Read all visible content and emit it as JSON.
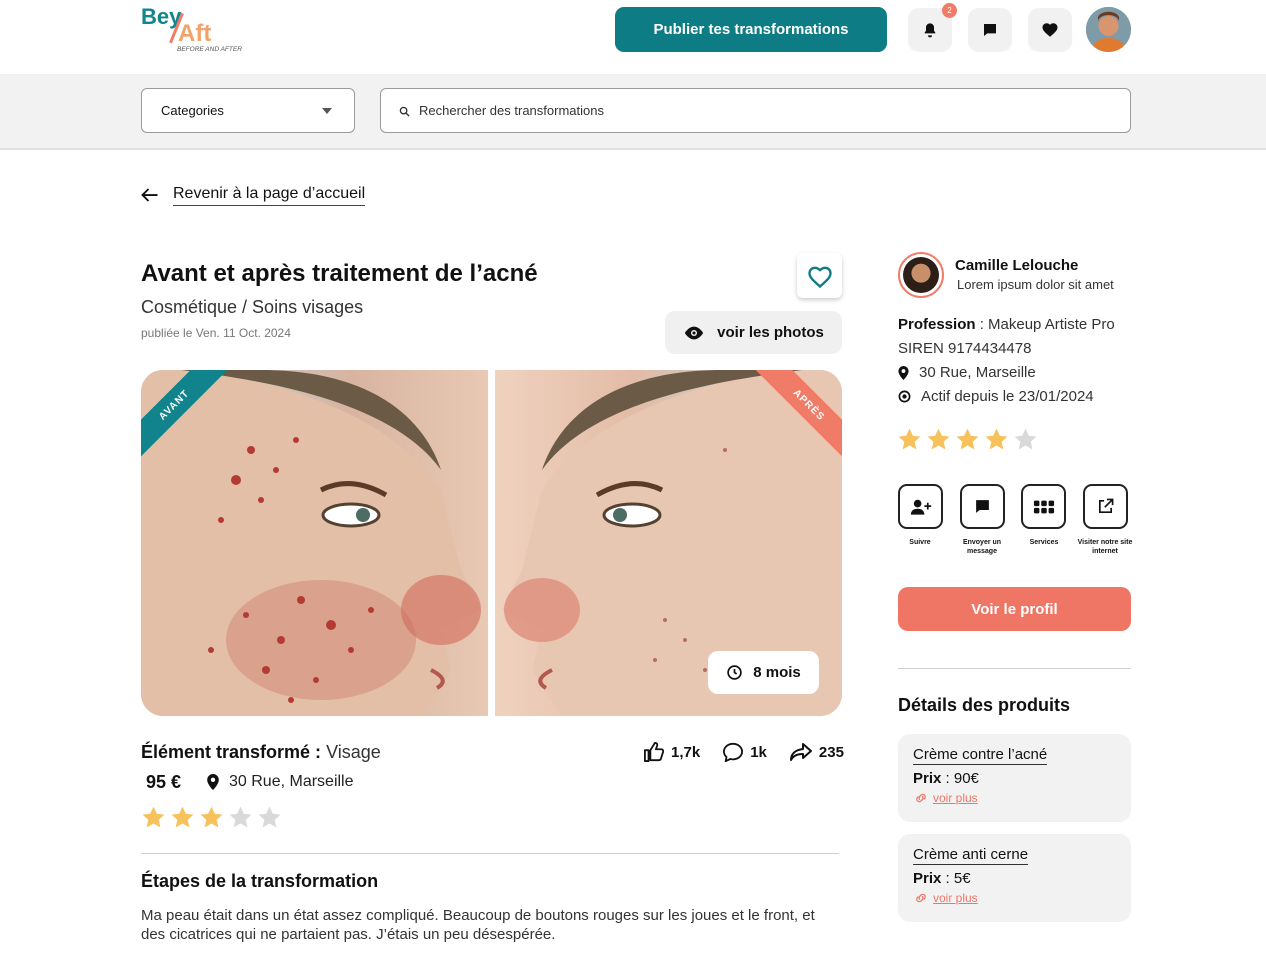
{
  "header": {
    "logo_top": "Bey",
    "logo_bottom": "Aft",
    "logo_tagline": "BEFORE AND AFTER",
    "publish_label": "Publier tes transformations",
    "notification_count": "2"
  },
  "filters": {
    "category_label": "Categories",
    "search_placeholder": "Rechercher des transformations"
  },
  "back_label": "Revenir à la page d’accueil",
  "post": {
    "title": "Avant et après traitement de l’acné",
    "subtitle": "Cosmétique / Soins visages",
    "published": "publiée le Ven. 11 Oct. 2024",
    "view_photos_label": "voir les photos",
    "before_label": "AVANT",
    "after_label": "APRÈS",
    "duration": "8 mois",
    "element_label": "Élément transformé :",
    "element_value": "Visage",
    "price": "95 €",
    "location": "30 Rue, Marseille",
    "rating": 3,
    "likes": "1,7k",
    "comments": "1k",
    "shares": "235",
    "steps_title": "Étapes de la transformation",
    "steps_text": "Ma peau était dans un état assez compliqué. Beaucoup de boutons rouges sur les joues et le front, et des cicatrices qui ne partaient pas. J’étais un peu désespérée."
  },
  "author": {
    "name": "Camille Lelouche",
    "description": "Lorem ipsum dolor sit amet",
    "profession_label": "Profession",
    "profession": " : Makeup Artiste Pro",
    "siren": "SIREN 9174434478",
    "address": "30 Rue, Marseille",
    "active_since": "Actif depuis le 23/01/2024",
    "rating": 4,
    "actions": {
      "follow": "Suivre",
      "message": "Envoyer un message",
      "services": "Services",
      "website": "Visiter notre site internet"
    },
    "profile_button": "Voir le profil"
  },
  "products": {
    "title": "Détails des produits",
    "items": [
      {
        "name": "Crème contre l’acné",
        "price_label": "Prix",
        "price": " : 90€",
        "more": "voir plus"
      },
      {
        "name": "Crème anti cerne",
        "price_label": "Prix",
        "price": " : 5€",
        "more": "voir plus"
      }
    ]
  },
  "colors": {
    "teal": "#0d7c84",
    "coral": "#ef7565",
    "star": "#f7c15c",
    "star_empty": "#d9d9d9"
  }
}
